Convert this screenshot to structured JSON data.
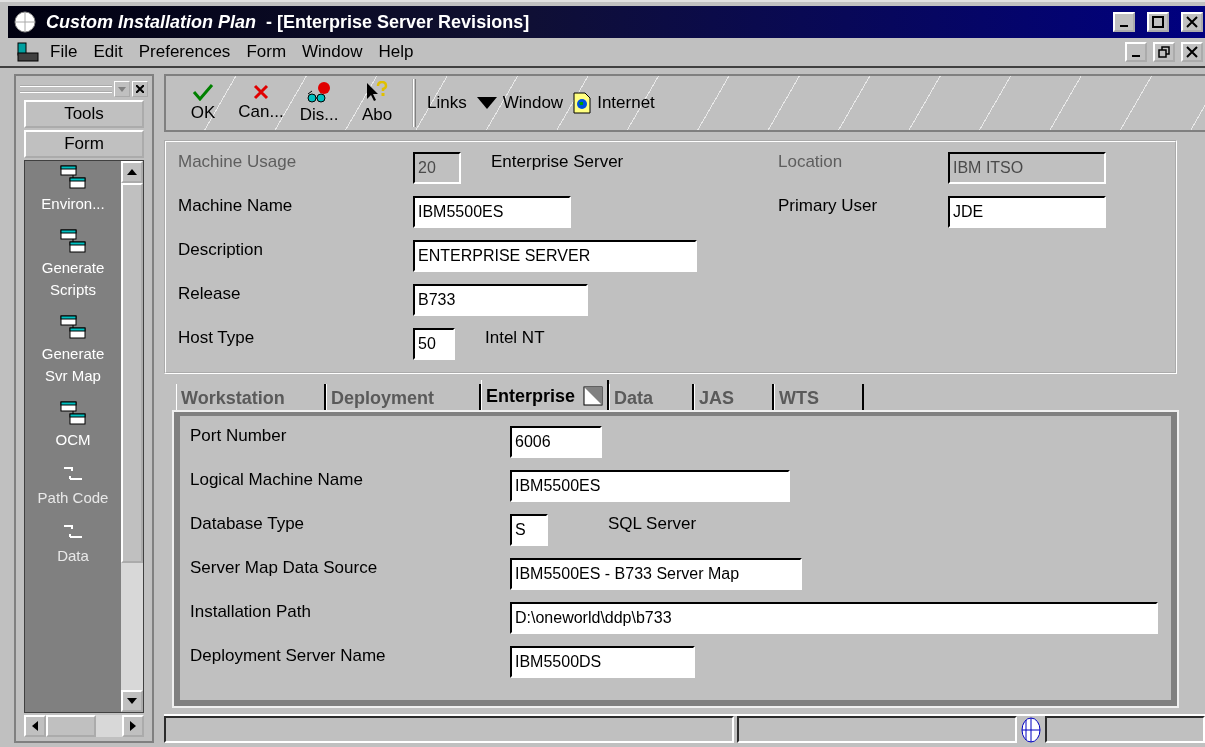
{
  "window": {
    "title": "Custom Installation Plan",
    "subtitle": "- [Enterprise Server Revisions]"
  },
  "menu": [
    "File",
    "Edit",
    "Preferences",
    "Form",
    "Window",
    "Help"
  ],
  "sidebar": {
    "buttons": [
      "Tools",
      "Form"
    ],
    "items": [
      {
        "kind": "form",
        "label": "Environ..."
      },
      {
        "kind": "form",
        "label": "Generate Scripts"
      },
      {
        "kind": "form",
        "label": "Generate Svr Map"
      },
      {
        "kind": "form",
        "label": "OCM"
      },
      {
        "kind": "option",
        "label": "Path Code"
      },
      {
        "kind": "option",
        "label": "Data"
      }
    ]
  },
  "toolbar": {
    "buttons": [
      {
        "kind": "ok",
        "label": "OK"
      },
      {
        "kind": "cancel",
        "label": "Can..."
      },
      {
        "kind": "display",
        "label": "Dis..."
      },
      {
        "kind": "about",
        "label": "Abo"
      }
    ],
    "links": [
      {
        "kind": "plain",
        "label": "Links"
      },
      {
        "kind": "dropdown",
        "label": "Window"
      },
      {
        "kind": "web",
        "label": "Internet"
      }
    ]
  },
  "header_fields": [
    {
      "label": "Machine Usage",
      "value": "20",
      "description": "Enterprise Server",
      "disabled": true
    },
    {
      "label": "Machine Name",
      "value": "IBM5500ES",
      "disabled": false
    },
    {
      "label": "Description",
      "value": "ENTERPRISE SERVER",
      "disabled": false
    },
    {
      "label": "Release",
      "value": "B733",
      "disabled": false
    },
    {
      "label": "Host Type",
      "value": "50",
      "description": "Intel NT",
      "disabled": false
    }
  ],
  "side_fields": [
    {
      "label": "Location",
      "value": "IBM ITSO",
      "disabled": true
    },
    {
      "label": "Primary User",
      "value": "JDE",
      "disabled": false
    }
  ],
  "tabs": [
    {
      "label": "Workstation",
      "selected": false
    },
    {
      "label": "Deployment",
      "selected": false
    },
    {
      "label": "Enterprise",
      "selected": true
    },
    {
      "label": "Data",
      "selected": false
    },
    {
      "label": "JAS",
      "selected": false
    },
    {
      "label": "WTS",
      "selected": false
    }
  ],
  "tab_fields": [
    {
      "label": "Port Number",
      "value": "6006"
    },
    {
      "label": "Logical Machine Name",
      "value": "IBM5500ES"
    },
    {
      "label": "Database Type",
      "value": "S",
      "description": "SQL Server"
    },
    {
      "label": "Server Map Data Source",
      "value": "IBM5500ES - B733 Server Map"
    },
    {
      "label": "Installation Path",
      "value": "D:\\oneworld\\ddp\\b733"
    },
    {
      "label": "Deployment Server Name",
      "value": "IBM5500DS"
    }
  ]
}
